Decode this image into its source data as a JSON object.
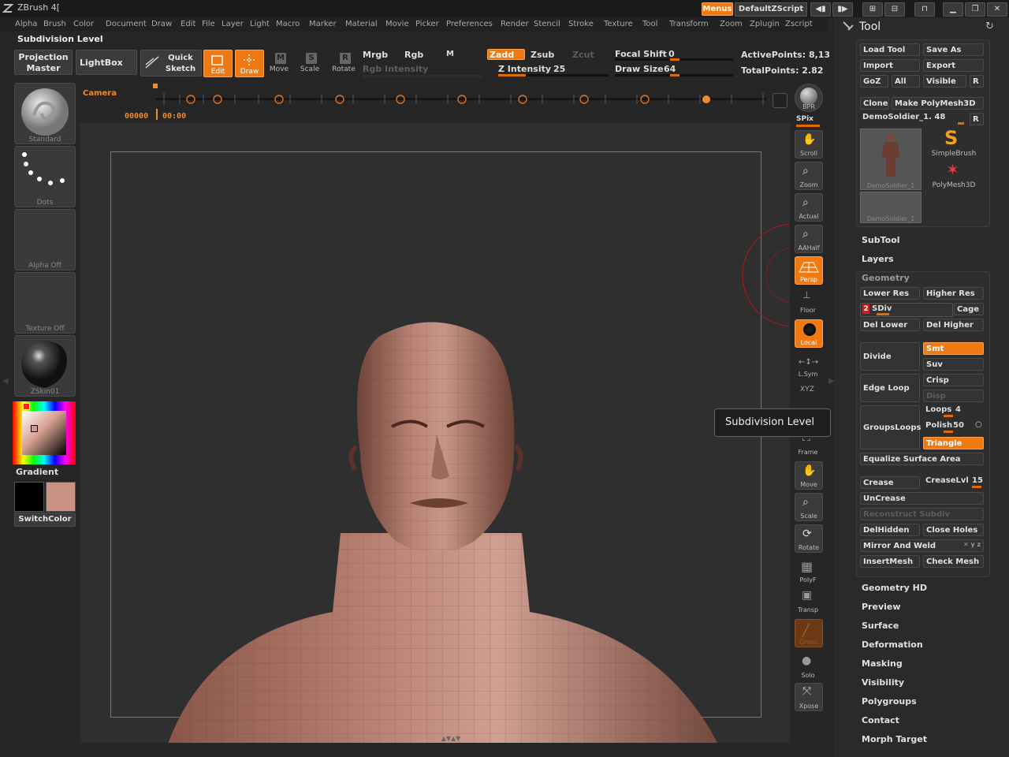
{
  "app": {
    "title": "ZBrush 4[",
    "menus_label": "Menus",
    "script_label": "DefaultZScript"
  },
  "menubar": [
    "Alpha",
    "Brush",
    "Color",
    "Document",
    "Draw",
    "Edit",
    "File",
    "Layer",
    "Light",
    "Macro",
    "Marker",
    "Material",
    "Movie",
    "Picker",
    "Preferences",
    "Render",
    "Stencil",
    "Stroke",
    "Texture",
    "Tool",
    "Transform",
    "Zoom",
    "Zplugin",
    "Zscript"
  ],
  "status_label": "Subdivision Level",
  "toolbar": {
    "projection_master": "Projection Master",
    "lightbox": "LightBox",
    "quick_sketch": "Quick Sketch",
    "edit": "Edit",
    "draw": "Draw",
    "move": "Move",
    "scale": "Scale",
    "rotate": "Rotate",
    "mrgb": "Mrgb",
    "rgb": "Rgb",
    "m": "M",
    "rgb_intensity": "Rgb Intensity",
    "zadd": "Zadd",
    "zsub": "Zsub",
    "zcut": "Zcut",
    "z_intensity_label": "Z Intensity",
    "z_intensity": "25",
    "z_intensity_level": 0.25,
    "focal_shift_label": "Focal Shift",
    "focal_shift": "0",
    "draw_size_label": "Draw Size",
    "draw_size": "64",
    "active_points": "ActivePoints: 8,13",
    "total_points": "TotalPoints: 2.82"
  },
  "timeline": {
    "camera": "Camera",
    "frame": "00000",
    "time": "00:00"
  },
  "left_shelf": {
    "brush": "Standard",
    "stroke": "Dots",
    "alpha": "Alpha Off",
    "texture": "Texture Off",
    "material": "ZSkin01",
    "gradient": "Gradient",
    "switch_color": "SwitchColor",
    "main_color": "#000000",
    "secondary_color": "#c99282"
  },
  "right_dock": {
    "bpr": "BPR",
    "spix": "SPix",
    "scroll": "Scroll",
    "zoom": "Zoom",
    "actual": "Actual",
    "aahalf": "AAHalf",
    "persp": "Persp",
    "floor": "Floor",
    "local": "Local",
    "lsym": "L.Sym",
    "xyz": "XYZ",
    "frame": "Frame",
    "move": "Move",
    "scale": "Scale",
    "rotate": "Rotate",
    "polyf": "PolyF",
    "transp": "Transp",
    "ghost": "Ghost",
    "solo": "Solo",
    "xpose": "Xpose"
  },
  "tooltip": "Subdivision Level",
  "tool_palette": {
    "title": "Tool",
    "load_tool": "Load Tool",
    "save_as": "Save As",
    "import": "Import",
    "export": "Export",
    "goz": "GoZ",
    "all": "All",
    "visible": "Visible",
    "r": "R",
    "clone": "Clone",
    "make_polymesh": "Make PolyMesh3D",
    "current_tool": "DemoSoldier_1. 48",
    "tool_thumbs": [
      "DemoSoldier_1",
      "SimpleBrush",
      "PolyMesh3D",
      "DemoSoldier_1"
    ],
    "subtool": "SubTool",
    "layers": "Layers",
    "geometry": {
      "header": "Geometry",
      "lower_res": "Lower Res",
      "higher_res": "Higher Res",
      "sdiv_value": "2",
      "sdiv_label": "SDiv",
      "cage": "Cage",
      "del_lower": "Del Lower",
      "del_higher": "Del Higher",
      "divide": "Divide",
      "smt": "Smt",
      "suv": "Suv",
      "edge_loop": "Edge Loop",
      "crisp": "Crisp",
      "disp": "Disp",
      "groups_loops": "GroupsLoops",
      "loops_label": "Loops",
      "loops": "4",
      "polish_label": "Polish",
      "polish": "50",
      "triangle": "Triangle",
      "equalize": "Equalize Surface Area",
      "crease": "Crease",
      "crease_lvl_label": "CreaseLvl",
      "crease_lvl": "15",
      "uncrease": "UnCrease",
      "reconstruct": "Reconstruct Subdiv",
      "del_hidden": "DelHidden",
      "close_holes": "Close Holes",
      "mirror_weld": "Mirror And Weld",
      "insert_mesh": "InsertMesh",
      "check_mesh": "Check Mesh"
    },
    "sections": [
      "Geometry HD",
      "Preview",
      "Surface",
      "Deformation",
      "Masking",
      "Visibility",
      "Polygroups",
      "Contact",
      "Morph Target"
    ]
  }
}
